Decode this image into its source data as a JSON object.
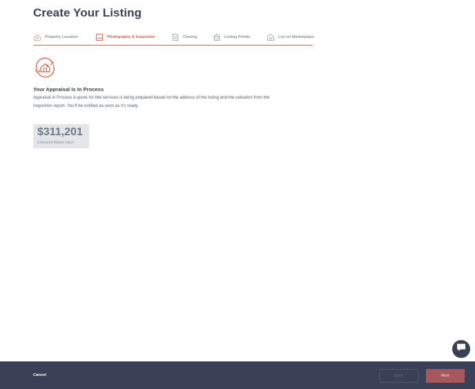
{
  "page": {
    "title": "Create Your Listing"
  },
  "steps": [
    {
      "label": "Property Location",
      "icon": "house-location-icon",
      "active": false
    },
    {
      "label": "Photography & Inspection",
      "icon": "photo-frame-icon",
      "active": true
    },
    {
      "label": "Closing",
      "icon": "document-icon",
      "active": false
    },
    {
      "label": "Listing Profile",
      "icon": "house-profile-icon",
      "active": false
    },
    {
      "label": "List on Marketplace",
      "icon": "house-marketplace-icon",
      "active": false
    }
  ],
  "appraisal": {
    "icon": "house-refresh-icon",
    "title": "Your Appraisal Is In Process",
    "body": "Appraisal in Process A quote for title services is being prepared based on the address of the listing and the valuation from the inspection report. You'll be notified as soon as it's ready."
  },
  "valuation": {
    "amount": "$311,201",
    "label": "Estimated Market Value"
  },
  "chat": {
    "icon": "chat-bubble-icon"
  },
  "footer": {
    "cancel_label": "Cancel",
    "back_label": "Back",
    "next_label": "Next"
  },
  "colors": {
    "accent": "#d96046",
    "footer_bg": "#3a4156",
    "next_bg": "#a8585d",
    "card_bg": "#e3e5e8"
  }
}
